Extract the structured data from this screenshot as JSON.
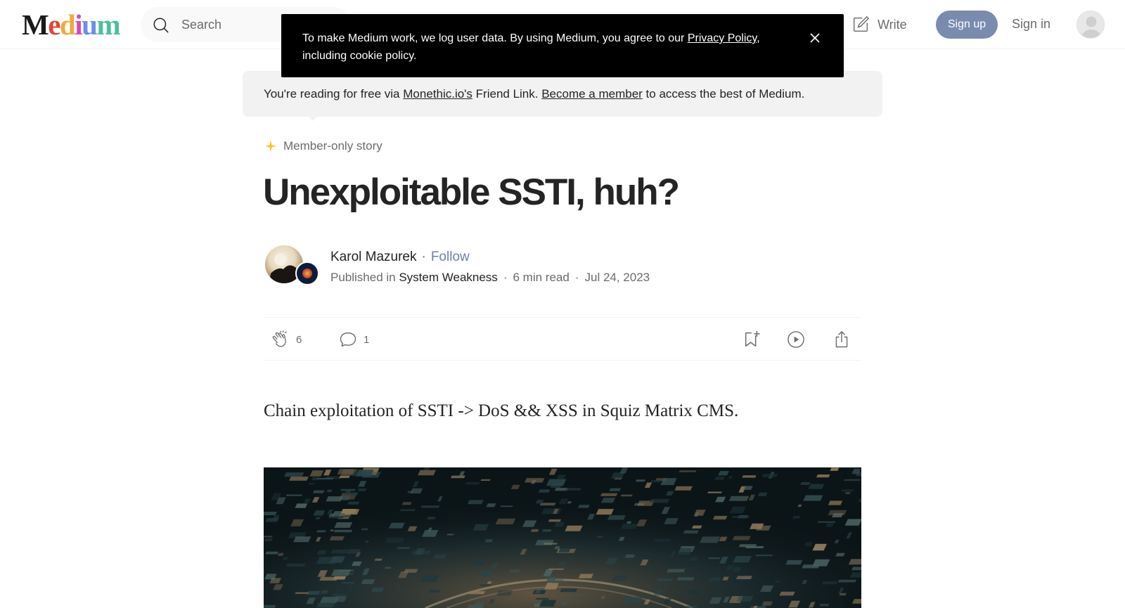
{
  "header": {
    "logo_text": "Medium",
    "logo_colors": [
      "#1a1a1a",
      "#e0463a",
      "#f2a93b",
      "#d44bb5",
      "#6a8fe8",
      "#4cbf9f"
    ],
    "search": {
      "placeholder": "Search"
    },
    "write_label": "Write",
    "signup_label": "Sign up",
    "signin_label": "Sign in"
  },
  "cookie_banner": {
    "text_before": "To make Medium work, we log user data. By using Medium, you agree to our ",
    "privacy_link": "Privacy Policy",
    "text_after": ", including cookie policy."
  },
  "friend_link": {
    "text_1": "You're reading for free via ",
    "link_1": "Monethic.io's",
    "text_2": " Friend Link. ",
    "link_2": "Become a member",
    "text_3": " to access the best of Medium."
  },
  "article": {
    "badge": "Member-only story",
    "title": "Unexploitable SSTI, huh?",
    "author": "Karol Mazurek",
    "follow_label": "Follow",
    "published_prefix": "Published in ",
    "publication": "System Weakness",
    "read_time": "6 min read",
    "date": "Jul 24, 2023",
    "claps": "6",
    "responses": "1",
    "subtitle": "Chain exploitation of SSTI -> DoS && XSS in Squiz Matrix CMS."
  },
  "colors": {
    "accent_follow": "#6f80a6",
    "signup_bg": "#7a8bb0",
    "member_star": "#ffc017",
    "text_primary": "#242424",
    "text_secondary": "#6b6b6b"
  },
  "icons": {
    "search": "search-icon",
    "write": "write-icon",
    "close": "close-icon",
    "star": "star-icon",
    "clap": "clap-icon",
    "comment": "comment-icon",
    "bookmark": "bookmark-icon",
    "listen": "play-icon",
    "share": "share-icon"
  }
}
